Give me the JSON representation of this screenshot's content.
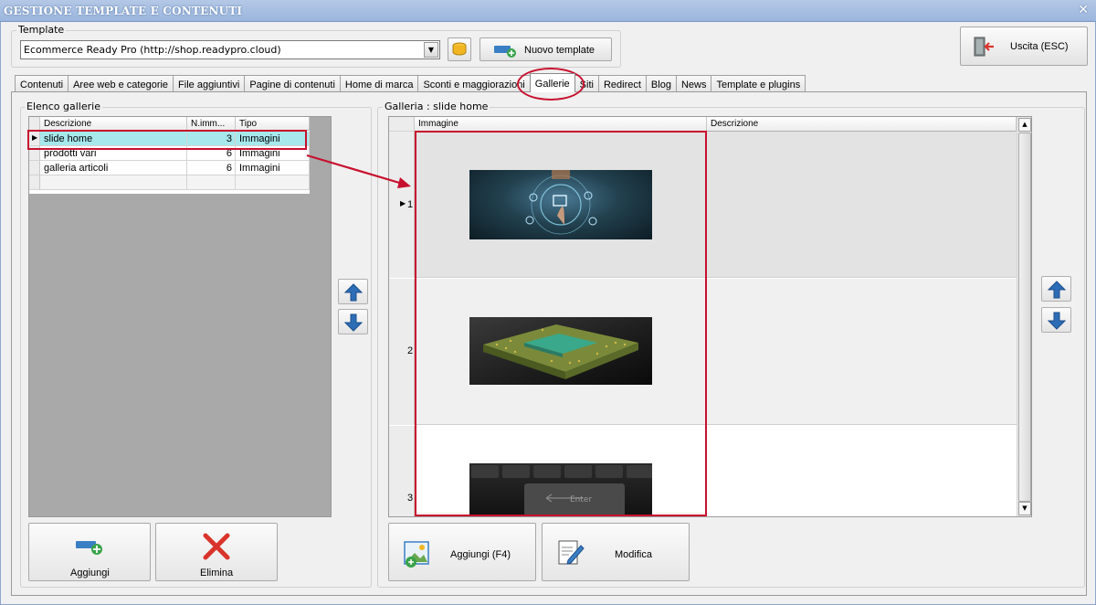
{
  "window": {
    "title": "GESTIONE TEMPLATE E CONTENUTI",
    "close_glyph": "✕"
  },
  "template": {
    "group_label": "Template",
    "selected": "Ecommerce Ready Pro (http://shop.readypro.cloud)",
    "new_template_label": "Nuovo template"
  },
  "exit_button": {
    "label": "Uscita (ESC)"
  },
  "tabs": [
    {
      "label": "Contenuti"
    },
    {
      "label": "Aree web e categorie"
    },
    {
      "label": "File aggiuntivi"
    },
    {
      "label": "Pagine di contenuti"
    },
    {
      "label": "Home di marca"
    },
    {
      "label": "Sconti e maggiorazioni"
    },
    {
      "label": "Gallerie",
      "active": true
    },
    {
      "label": "Siti"
    },
    {
      "label": "Redirect"
    },
    {
      "label": "Blog"
    },
    {
      "label": "News"
    },
    {
      "label": "Template e plugins"
    }
  ],
  "galleries": {
    "group_label": "Elenco gallerie",
    "columns": [
      "Descrizione",
      "N.imm...",
      "Tipo"
    ],
    "rows": [
      {
        "desc": "slide home",
        "count": "3",
        "type": "Immagini",
        "selected": true
      },
      {
        "desc": "prodotti vari",
        "count": "6",
        "type": "Immagini"
      },
      {
        "desc": "galleria articoli",
        "count": "6",
        "type": "Immagini"
      }
    ],
    "add_label": "Aggiungi",
    "delete_label": "Elimina"
  },
  "gallery_detail": {
    "group_label": "Galleria : slide home",
    "columns": [
      "Immagine",
      "Descrizione"
    ],
    "rows": [
      {
        "num": "1",
        "image": "tech-touch-interface"
      },
      {
        "num": "2",
        "image": "cpu-chip"
      },
      {
        "num": "3",
        "image": "keyboard-enter-key"
      }
    ],
    "add_label": "Aggiungi (F4)",
    "edit_label": "Modifica"
  },
  "colors": {
    "selected_row": "#a6e8ec",
    "annotation_red": "#c8102e",
    "arrow_blue": "#2d6db5"
  }
}
